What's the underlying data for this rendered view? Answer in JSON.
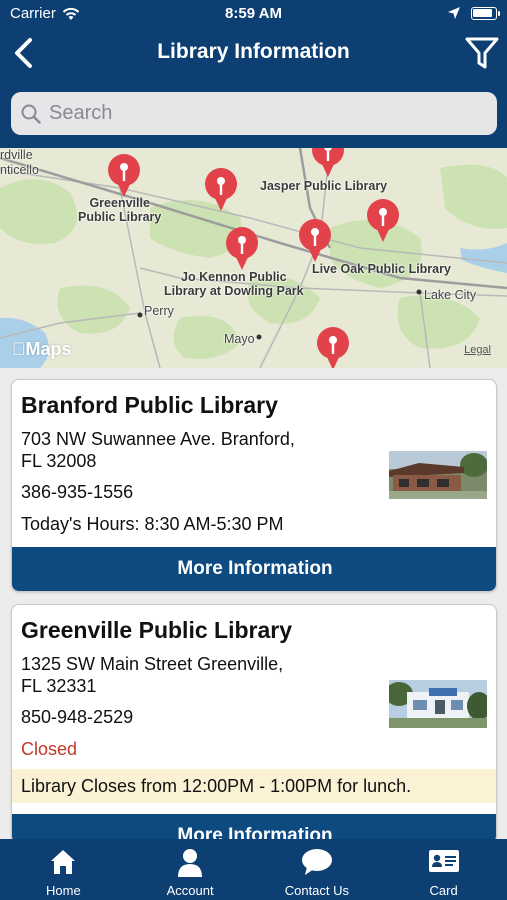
{
  "status": {
    "carrier": "Carrier",
    "time": "8:59 AM",
    "battery_level": 0.95
  },
  "nav": {
    "title": "Library Information"
  },
  "search": {
    "placeholder": "Search",
    "value": ""
  },
  "map": {
    "labels": {
      "greenville": "Greenville\nPublic Library",
      "jasper": "Jasper Public Library",
      "live_oak": "Live Oak Public Library",
      "jo_kennon": "Jo Kennon Public\nLibrary at Dowling Park",
      "lake_city": "Lake City",
      "perry": "Perry",
      "mayo": "Mayo",
      "madison_partial": "rdville",
      "monticello_partial": "nticello"
    },
    "maps_logo": "Maps",
    "legal": "Legal",
    "colors": {
      "land": "#e7e9d5",
      "green": "#cde2b3",
      "water": "#a9cfe9",
      "pin": "#e2434b"
    }
  },
  "libraries": [
    {
      "name": "Branford Public Library",
      "address_line1": "703 NW Suwannee Ave.  Branford,",
      "address_line2": "FL 32008",
      "phone": "386-935-1556",
      "hours": "Today's Hours:  8:30 AM-5:30 PM",
      "button": "More Information"
    },
    {
      "name": "Greenville Public Library",
      "address_line1": "1325 SW Main Street  Greenville,",
      "address_line2": "FL 32331",
      "phone": "850-948-2529",
      "status": "Closed",
      "notice": "Library Closes from 12:00PM - 1:00PM for lunch.",
      "button": "More Information"
    }
  ],
  "tabs": [
    {
      "label": "Home",
      "icon": "home-icon"
    },
    {
      "label": "Account",
      "icon": "person-icon"
    },
    {
      "label": "Contact Us",
      "icon": "chat-bubble-icon"
    },
    {
      "label": "Card",
      "icon": "id-card-icon"
    }
  ],
  "colors": {
    "header": "#0d3f73",
    "button": "#0d4a80",
    "closed": "#c0392b",
    "notice": "#fbf2d5"
  }
}
